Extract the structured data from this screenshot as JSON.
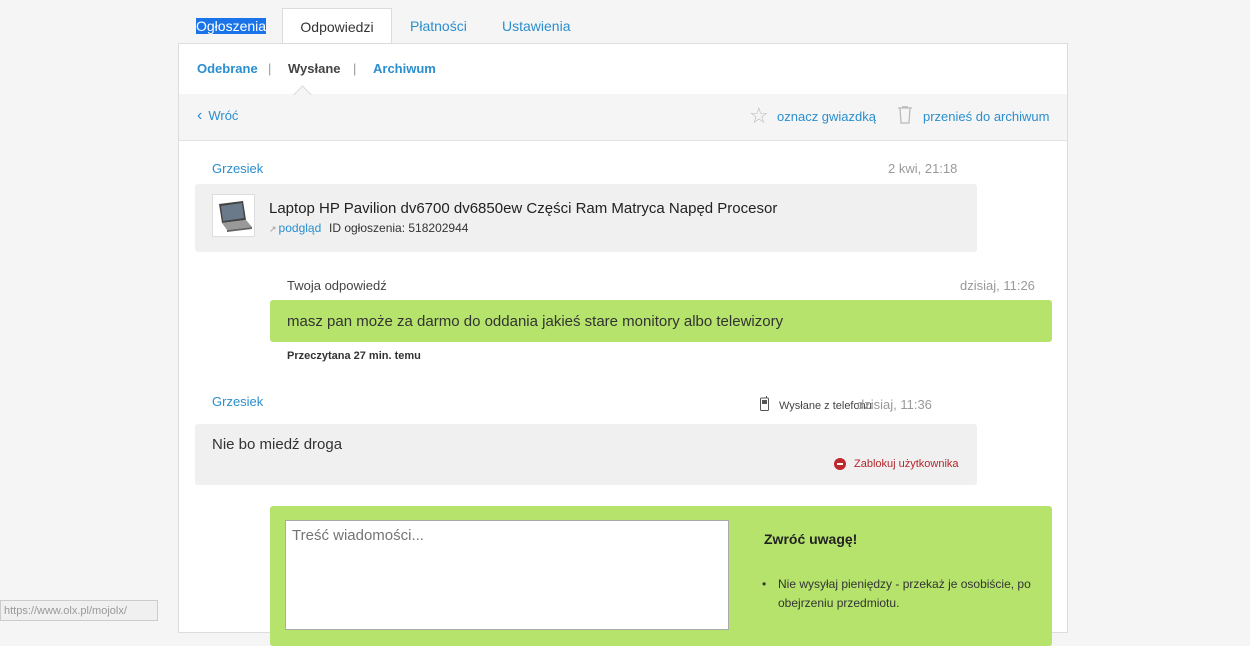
{
  "tabs": [
    {
      "label": "Ogłoszenia"
    },
    {
      "label": "Odpowiedzi"
    },
    {
      "label": "Płatności"
    },
    {
      "label": "Ustawienia"
    }
  ],
  "subtabs": {
    "received": "Odebrane",
    "sent": "Wysłane",
    "archive": "Archiwum",
    "separator": "|"
  },
  "toolbar": {
    "back": "Wróć",
    "back_icon": "‹",
    "star_icon": "☆",
    "star": "oznacz gwiazdką",
    "archive": "przenieś do archiwum"
  },
  "listing": {
    "sender": "Grzesiek",
    "time": "2 kwi, 21:18",
    "title": "Laptop HP Pavilion dv6700 dv6850ew Części Ram Matryca Napęd Procesor",
    "preview": "podgląd",
    "preview_icon": "↗",
    "id_text": "ID ogłoszenia: 518202944"
  },
  "reply": {
    "label": "Twoja odpowiedź",
    "time": "dzisiaj, 11:26",
    "text": "masz pan może za darmo do oddania jakieś stare monitory albo telewizory",
    "read_status": "Przeczytana 27 min. temu"
  },
  "message2": {
    "sender": "Grzesiek",
    "phone": "Wysłane z telefonu",
    "time": "dzisiaj, 11:36",
    "text": "Nie bo miedź droga",
    "block": "Zablokuj użytkownika"
  },
  "compose": {
    "placeholder": "Treść wiadomości...",
    "notice_title": "Zwróć uwagę!",
    "notice_item": "Nie wysyłaj pieniędzy - przekaż je osobiście, po obejrzeniu przedmiotu."
  },
  "statusbar": {
    "url": "https://www.olx.pl/mojolx/"
  }
}
